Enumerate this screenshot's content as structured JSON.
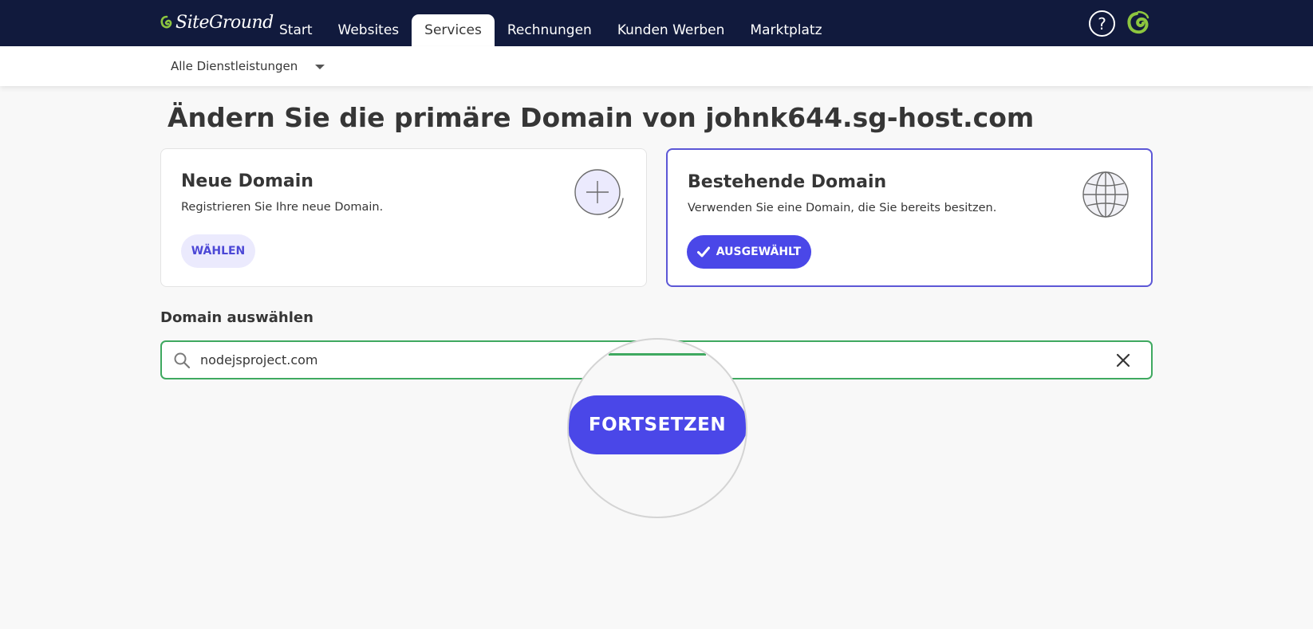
{
  "header": {
    "logo_text": "SiteGround",
    "help_symbol": "?",
    "nav": [
      "Start",
      "Websites",
      "Services",
      "Rechnungen",
      "Kunden Werben",
      "Marktplatz"
    ],
    "active_nav": "Services",
    "help_icon": "question-circle-icon",
    "brand_icon": "siteground-swirl-icon"
  },
  "subnav": {
    "selected": "Alle Dienstleistungen"
  },
  "page": {
    "title": "Ändern Sie die primäre Domain von johnk644.sg-host.com"
  },
  "cards": {
    "new": {
      "title": "Neue Domain",
      "description": "Registrieren Sie Ihre neue Domain.",
      "button": "WÄHLEN",
      "icon": "plus-circle-icon"
    },
    "existing": {
      "title": "Bestehende Domain",
      "description": "Verwenden Sie eine Domain, die Sie bereits besitzen.",
      "button": "AUSGEWÄHLT",
      "icon": "globe-icon"
    }
  },
  "domain_select": {
    "label": "Domain auswählen",
    "value": "nodejsproject.com"
  },
  "actions": {
    "continue": "FORTSETZEN"
  },
  "colors": {
    "header_bg": "#111a3d",
    "primary": "#4a47e8",
    "selected_border": "#5c57d6",
    "success": "#3fa960",
    "logo_green": "#8dc63f"
  }
}
